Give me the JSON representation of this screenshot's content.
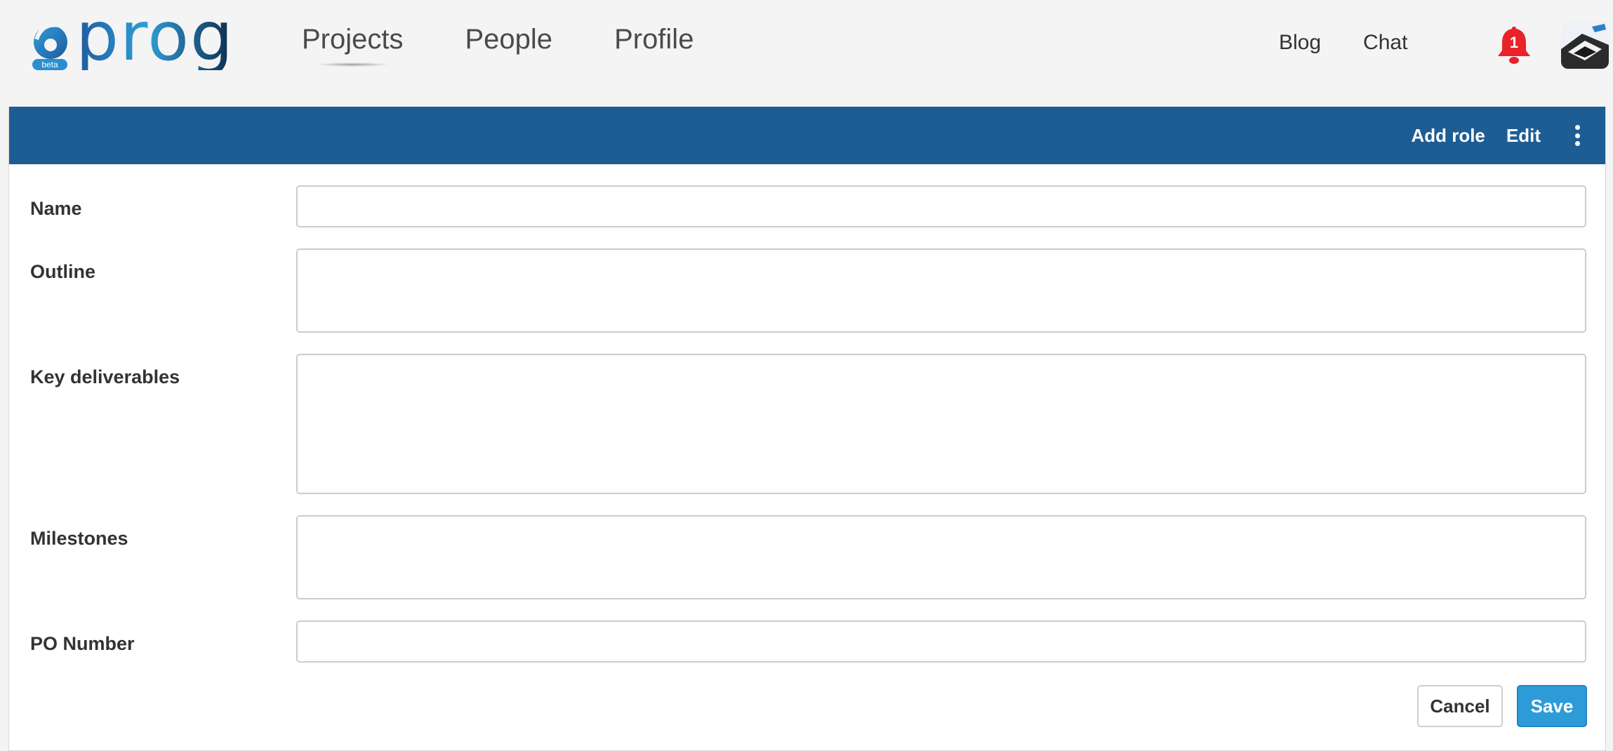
{
  "logo": {
    "wordmark": "prog",
    "badge": "beta"
  },
  "nav": {
    "items": [
      {
        "label": "Projects",
        "active": true
      },
      {
        "label": "People",
        "active": false
      },
      {
        "label": "Profile",
        "active": false
      }
    ]
  },
  "utility": {
    "blog": "Blog",
    "chat": "Chat",
    "notification_count": "1"
  },
  "panel": {
    "actions": {
      "add_role": "Add role",
      "edit": "Edit"
    }
  },
  "form": {
    "fields": [
      {
        "label": "Name",
        "value": "",
        "type": "input"
      },
      {
        "label": "Outline",
        "value": "",
        "type": "textarea"
      },
      {
        "label": "Key deliverables",
        "value": "",
        "type": "textarea"
      },
      {
        "label": "Milestones",
        "value": "",
        "type": "textarea"
      },
      {
        "label": "PO Number",
        "value": "",
        "type": "input"
      }
    ],
    "cancel_label": "Cancel",
    "save_label": "Save"
  },
  "colors": {
    "header_blue": "#1e5d94",
    "save_blue": "#2d9bd8",
    "bell_red": "#e8232a",
    "page_bg": "#f4f4f4"
  }
}
